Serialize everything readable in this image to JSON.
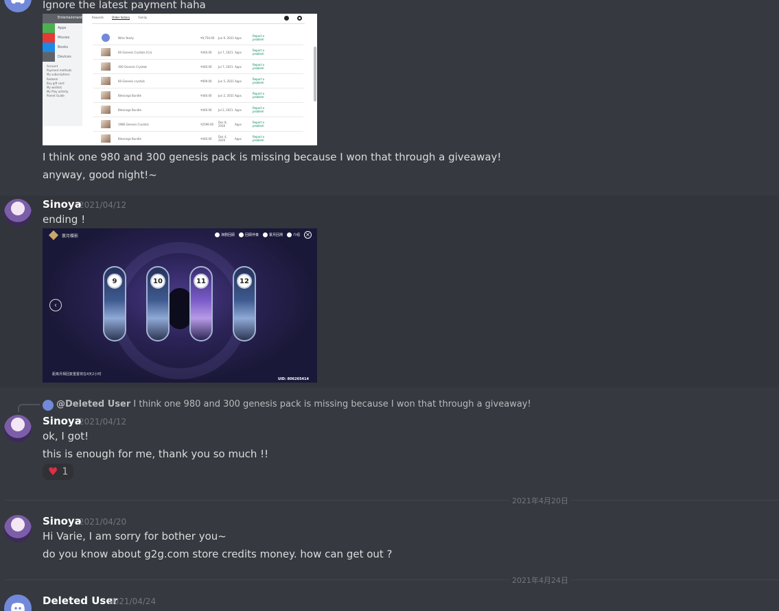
{
  "messages": {
    "m1": {
      "line_top": "Ignore the latest payment haha",
      "line1": "I think one 980 and 300 genesis pack is missing because I won that through a giveaway!",
      "line2": "anyway, good night!~"
    },
    "m2": {
      "author": "Sinoya",
      "timestamp": "2021/04/12",
      "text": "ending !"
    },
    "m3": {
      "reply": {
        "author": "@Deleted User",
        "text": "I think one 980 and 300 genesis pack is missing because I won that through a giveaway!"
      },
      "author": "Sinoya",
      "timestamp": "2021/04/12",
      "line1": "ok, I got!",
      "line2": "this is enough for me, thank you so much !!",
      "reaction": {
        "emoji": "❤️",
        "count": "1"
      }
    },
    "divider1": "2021年4月20日",
    "m4": {
      "author": "Sinoya",
      "timestamp": "2021/04/20",
      "line1": "Hi Varie, I am sorry for bother you~",
      "line2": "do you know about g2g.com store credits money. how can get out ?"
    },
    "divider2": "2021年4月24日",
    "m5": {
      "author": "Deleted User",
      "timestamp": "2021/04/24"
    }
  },
  "screenshot1": {
    "sidebar_header": "Entertainment",
    "sidebar_items": [
      "Apps",
      "Movies",
      "Books",
      "Devices"
    ],
    "sidebar_links": [
      "Account",
      "Payment methods",
      "My subscriptions",
      "Redeem",
      "Buy gift card",
      "My wishlist",
      "My Play activity",
      "Parent Guide"
    ],
    "tabs": [
      "Rewards",
      "Order history",
      "Family"
    ],
    "rows": [
      {
        "item": "Nitro Yearly",
        "price": "₹9,750.00",
        "date": "Jun 9, 2021",
        "type": "Apps",
        "action": "Report a problem"
      },
      {
        "item": "60 Genesis Crystals (Ca)",
        "price": "₹440.00",
        "date": "Jul 7, 2021",
        "type": "Apps",
        "action": "Report a problem"
      },
      {
        "item": "300 Genesis Crystals",
        "price": "₹440.00",
        "date": "Jul 7, 2021",
        "type": "Apps",
        "action": "Report a problem"
      },
      {
        "item": "60 Genesis crystals",
        "price": "₹909.00",
        "date": "Jun 5, 2021",
        "type": "Apps",
        "action": "Report a problem"
      },
      {
        "item": "Blessings Bundle",
        "price": "₹440.00",
        "date": "Jun 2, 2021",
        "type": "Apps",
        "action": "Report a problem"
      },
      {
        "item": "Blessings Bundle",
        "price": "₹440.00",
        "date": "Jul 2, 2021",
        "type": "Apps",
        "action": "Report a problem"
      },
      {
        "item": "1980 Genesis Crystals",
        "price": "₹2599.00",
        "date": "Dec 8, 2020",
        "type": "Apps",
        "action": "Report a problem"
      },
      {
        "item": "Blessings Bundle",
        "price": "₹440.00",
        "date": "Dec 4, 2020",
        "type": "Apps",
        "action": "Report a problem"
      }
    ]
  },
  "screenshot2": {
    "title": "寰月蝶影",
    "menu": [
      "演剧回顾",
      "回顾伴奏",
      "寰月回溯",
      "介绍"
    ],
    "cards": [
      "9",
      "10",
      "11",
      "12"
    ],
    "footer_left": "距离月相回复重置将在4天2小时",
    "footer_right": "UID: 806265414"
  }
}
